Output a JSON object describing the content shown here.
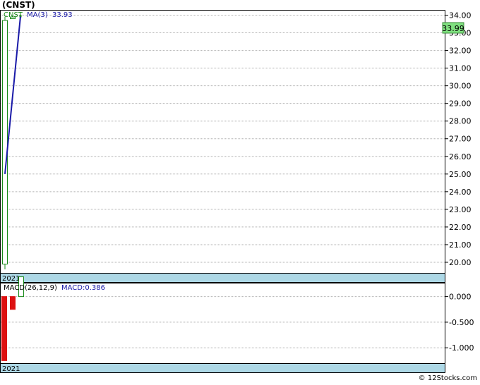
{
  "title": "(CNST)",
  "footer": "© 12Stocks.com",
  "chart_data": [
    {
      "type": "candlestick",
      "legend": {
        "symbol": "CNST",
        "ma_label": "MA(3)",
        "ma_value": "33.93"
      },
      "last_price_label": "33.99",
      "x_label": "2021",
      "ylim": [
        19.4,
        34.3
      ],
      "yticks": [
        "34.00",
        "33.00",
        "32.00",
        "31.00",
        "30.00",
        "29.00",
        "28.00",
        "27.00",
        "26.00",
        "25.00",
        "24.00",
        "23.00",
        "22.00",
        "21.00",
        "20.00"
      ],
      "grid": true,
      "candles": [
        {
          "open": 19.9,
          "high": 33.9,
          "low": 19.6,
          "close": 33.7
        },
        {
          "open": 33.8,
          "high": 33.95,
          "low": 33.8,
          "close": 33.9
        },
        {
          "open": 33.9,
          "high": 34.05,
          "low": 33.8,
          "close": 33.99
        }
      ],
      "ma_series": {
        "name": "MA(3)",
        "values": [
          25.0,
          33.93
        ]
      },
      "colors": {
        "up": "#1a8a1a",
        "ma": "#1a1aa8",
        "price_badge": "#7fe07f"
      }
    },
    {
      "type": "bar",
      "legend": {
        "label": "MACD(26,12,9)",
        "macd_label": "MACD:0.386"
      },
      "x_label": "2021",
      "ylim": [
        -1.3,
        0.27
      ],
      "yticks": [
        "0.000",
        "-0.500",
        "-1.000"
      ],
      "grid": true,
      "values": [
        -1.25,
        -0.25,
        0.386
      ],
      "colors": {
        "negative": "#dd1111",
        "positive": "#1a8a1a"
      }
    }
  ]
}
